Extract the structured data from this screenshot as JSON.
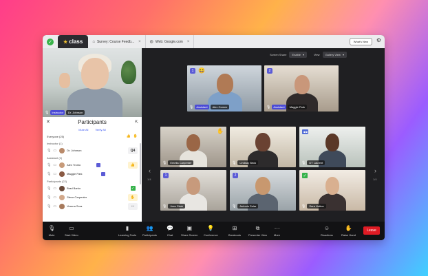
{
  "tabs": {
    "active": "class",
    "tab1": "Survey: Course Feedb...",
    "tab2": "Web: Google.com",
    "whats_new": "What's New"
  },
  "self_video": {
    "role": "Instructor",
    "name": "Dr. Johnson"
  },
  "participants": {
    "title": "Participants",
    "mute_all": "Mute All",
    "unmute_all": "Verify All",
    "everyone": "Everyone (25)",
    "instructor_header": "Instructor (1)",
    "instructor": {
      "name": "Dr. Johnson",
      "status": "Q4"
    },
    "assistant_header": "Assistant (2)",
    "assistants": [
      {
        "name": "Alex Tronio"
      },
      {
        "name": "Maggie Park"
      }
    ],
    "participants_header": "Participants (22)",
    "people": [
      {
        "name": "Brad Barko"
      },
      {
        "name": "Steve Carpenter"
      },
      {
        "name": "Verena Sora"
      }
    ]
  },
  "top_controls": {
    "screen_share_label": "Screen Share",
    "screen_share_value": "Enable",
    "view_label": "View",
    "view_value": "Gallery View"
  },
  "top_tiles": [
    {
      "role": "Assistant",
      "name": "Alex Gomez",
      "num": "1"
    },
    {
      "role": "Assistant",
      "name": "Maggie Park",
      "num": "2"
    }
  ],
  "tiles": [
    {
      "name": "Emelia Carpenter"
    },
    {
      "name": "Lindsay Beck"
    },
    {
      "name": "DT Laurent"
    },
    {
      "name": "Jess Clark",
      "num": "1"
    },
    {
      "name": "Antonio Solar",
      "num": "2"
    },
    {
      "name": "Sara Hutton"
    }
  ],
  "pager": {
    "left": "1/4",
    "right": "1/4"
  },
  "toolbar": {
    "mute": "Mute",
    "start_video": "Start Video",
    "learning_tools": "Learning Tools",
    "participants": "Participants",
    "chat": "Chat",
    "share_screen": "Share Screen",
    "conference": "Conference",
    "breakouts": "Breakouts",
    "presenter_view": "Presenter View",
    "more": "More",
    "reactions": "Reactions",
    "raise_hand": "Raise Hand",
    "leave": "Leave"
  },
  "colors": {
    "accent": "#5b5bd6",
    "leave": "#e01b24",
    "dark_bg": "#1f1f22"
  }
}
